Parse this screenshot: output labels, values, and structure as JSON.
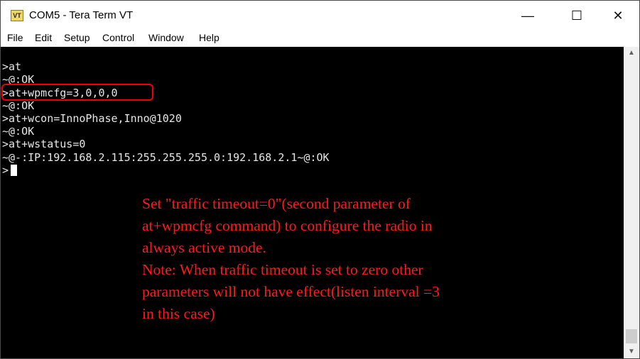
{
  "window": {
    "title": "COM5 - Tera Term VT",
    "icon_text": "VT"
  },
  "window_controls": {
    "minimize": "—",
    "maximize": "☐",
    "close": "✕"
  },
  "menu": [
    "File",
    "Edit",
    "Setup",
    "Control",
    "Window",
    "Help"
  ],
  "terminal": {
    "lines": [
      ">at",
      "~@:OK",
      ">at+wpmcfg=3,0,0,0",
      "~@:OK",
      ">at+wcon=InnoPhase,Inno@1020",
      "~@:OK",
      ">at+wstatus=0",
      "~@-:IP:192.168.2.115:255.255.255.0:192.168.2.1~@:OK",
      ">"
    ]
  },
  "annotation": {
    "lines": [
      "Set \"traffic timeout=0\"(second parameter of",
      "at+wpmcfg command) to configure the radio in",
      "always active mode.",
      "Note: When traffic timeout is set to zero other",
      "parameters will not have effect(listen interval =3",
      "in this case)"
    ],
    "color": "#ff1a1a"
  },
  "scrollbar": {
    "up": "▲",
    "down": "▼"
  }
}
